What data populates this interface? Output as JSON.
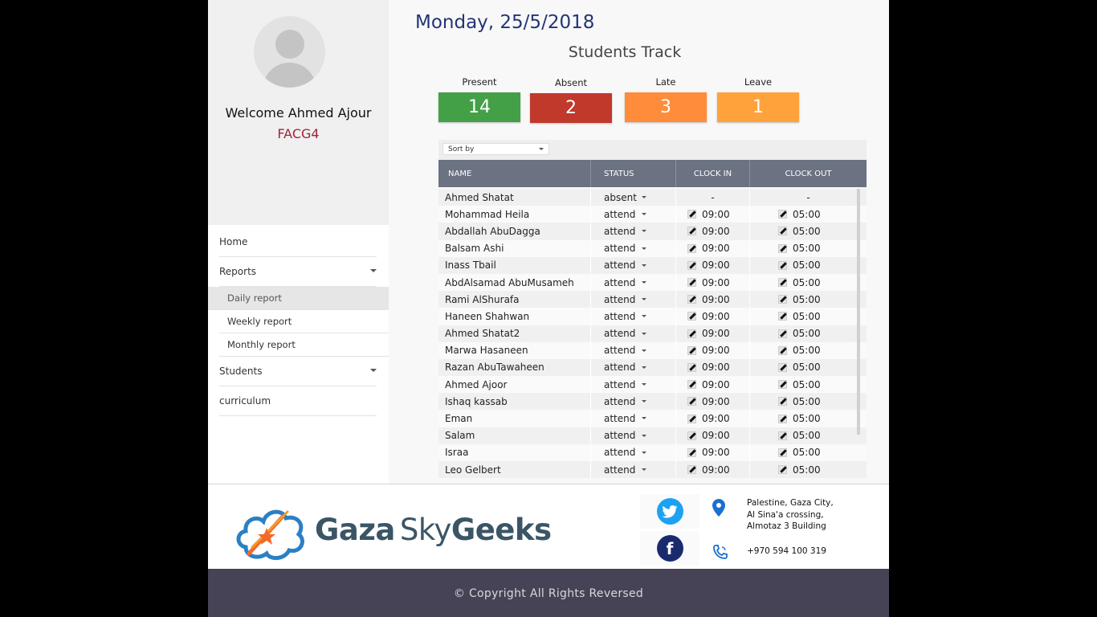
{
  "profile": {
    "welcome": "Welcome Ahmed Ajour",
    "group": "FACG4"
  },
  "nav": {
    "home": "Home",
    "reports": "Reports",
    "reports_sub": [
      "Daily report",
      "Weekly report",
      "Monthly report"
    ],
    "students": "Students",
    "curriculum": "curriculum"
  },
  "main": {
    "date": "Monday, 25/5/2018",
    "title": "Students Track",
    "stats": [
      {
        "label": "Present",
        "value": "14",
        "color": "#43a047"
      },
      {
        "label": "Absent",
        "value": "2",
        "color": "#c0392b"
      },
      {
        "label": "Late",
        "value": "3",
        "color": "#ff8c3a"
      },
      {
        "label": "Leave",
        "value": "1",
        "color": "#ffa23c"
      }
    ],
    "sort_placeholder": "Sort by",
    "columns": [
      "NAME",
      "STATUS",
      "CLOCK IN",
      "CLOCK OUT"
    ],
    "rows": [
      {
        "name": "Ahmed Shatat",
        "status": "absent",
        "in": "-",
        "out": "-"
      },
      {
        "name": "Mohammad Heila",
        "status": "attend",
        "in": "09:00",
        "out": "05:00"
      },
      {
        "name": "Abdallah AbuDagga",
        "status": "attend",
        "in": "09:00",
        "out": "05:00"
      },
      {
        "name": "Balsam Ashi",
        "status": "attend",
        "in": "09:00",
        "out": "05:00"
      },
      {
        "name": "Inass Tbail",
        "status": "attend",
        "in": "09:00",
        "out": "05:00"
      },
      {
        "name": "AbdAlsamad  AbuMusameh",
        "status": "attend",
        "in": "09:00",
        "out": "05:00"
      },
      {
        "name": "Rami AlShurafa",
        "status": "attend",
        "in": "09:00",
        "out": "05:00"
      },
      {
        "name": "Haneen Shahwan",
        "status": "attend",
        "in": "09:00",
        "out": "05:00"
      },
      {
        "name": "Ahmed Shatat2",
        "status": "attend",
        "in": "09:00",
        "out": "05:00"
      },
      {
        "name": "Marwa Hasaneen",
        "status": "attend",
        "in": "09:00",
        "out": "05:00"
      },
      {
        "name": "Razan AbuTawaheen",
        "status": "attend",
        "in": "09:00",
        "out": "05:00"
      },
      {
        "name": "Ahmed Ajoor",
        "status": "attend",
        "in": "09:00",
        "out": "05:00"
      },
      {
        "name": "Ishaq kassab",
        "status": "attend",
        "in": "09:00",
        "out": "05:00"
      },
      {
        "name": "Eman",
        "status": "attend",
        "in": "09:00",
        "out": "05:00"
      },
      {
        "name": "Salam",
        "status": "attend",
        "in": "09:00",
        "out": "05:00"
      },
      {
        "name": "Israa",
        "status": "attend",
        "in": "09:00",
        "out": "05:00"
      },
      {
        "name": "Leo Gelbert",
        "status": "attend",
        "in": "09:00",
        "out": "05:00"
      }
    ]
  },
  "footer": {
    "logo_word1": "Gaza",
    "logo_word2": "Sky",
    "logo_word3": "Geeks",
    "address_lines": [
      "Palestine, Gaza City,",
      "Al Sina'a crossing,",
      "Almotaz 3 Building"
    ],
    "phone": "+970 594 100 319",
    "copyright": "© Copyright All Rights Reversed",
    "twitter_color": "#1da1f2",
    "facebook_color": "#1a2b6d"
  }
}
